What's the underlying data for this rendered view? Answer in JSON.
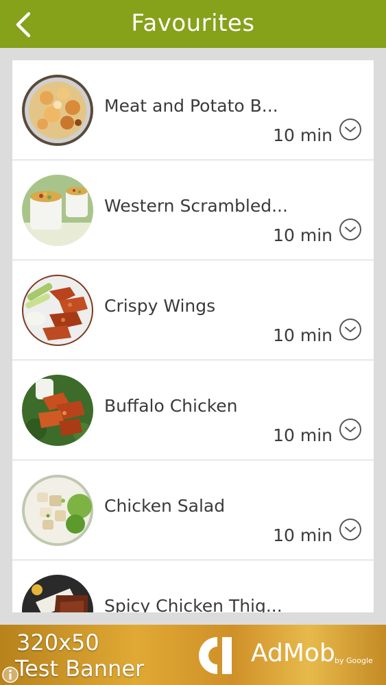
{
  "header": {
    "title": "Favourites",
    "color": "#86a11a"
  },
  "favourites": [
    {
      "name": "Meat and Potato B...",
      "time": "10 min"
    },
    {
      "name": "Western Scrambled...",
      "time": "10 min"
    },
    {
      "name": "Crispy Wings",
      "time": "10 min"
    },
    {
      "name": "Buffalo Chicken",
      "time": "10 min"
    },
    {
      "name": "Chicken Salad",
      "time": "10 min"
    },
    {
      "name": "Spicy Chicken Thig...",
      "time": ""
    }
  ],
  "ad": {
    "size_text": "320x50",
    "label": "Test Banner",
    "brand": "AdMob",
    "byline": "by Google"
  },
  "icons": {
    "back": "chevron-left-icon",
    "time": "clock-icon",
    "info": "info-icon"
  }
}
